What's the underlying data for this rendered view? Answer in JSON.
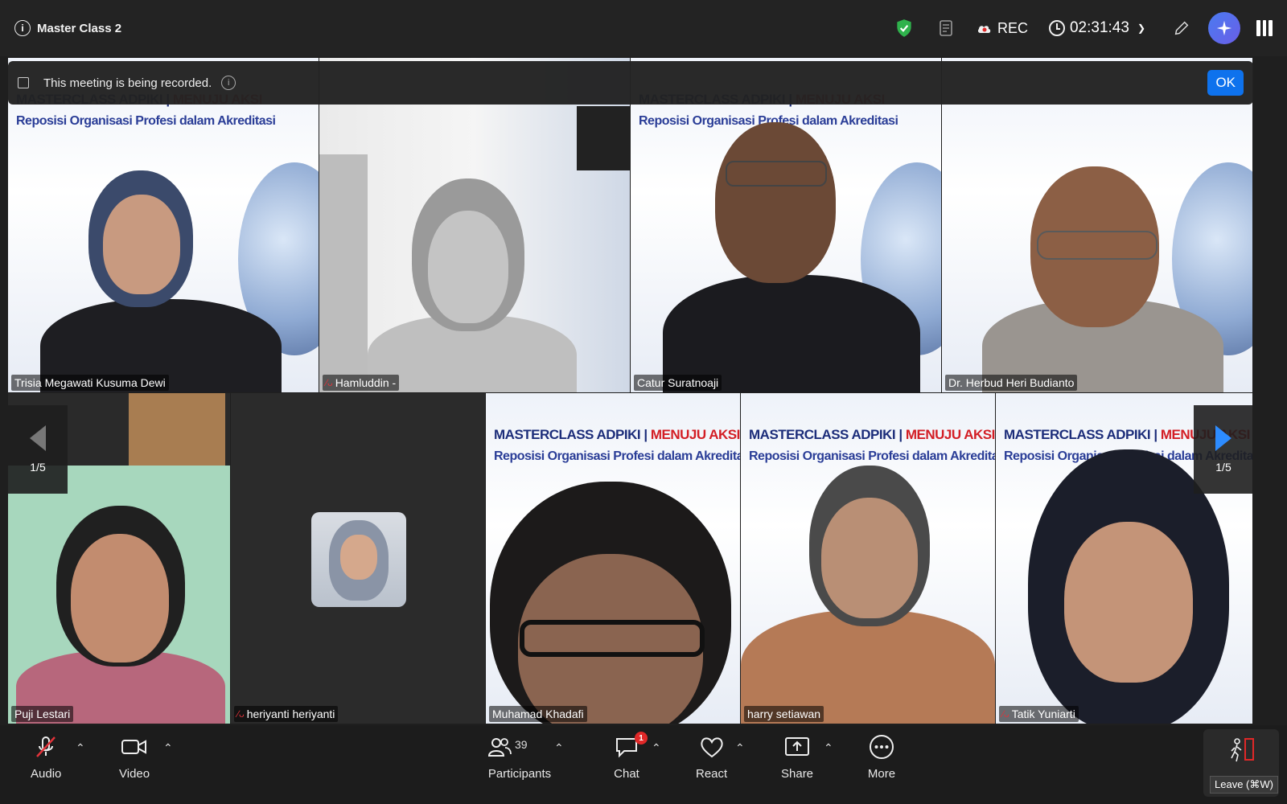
{
  "meeting": {
    "title": "Master Class 2"
  },
  "topbar": {
    "rec_label": "REC",
    "timer": "02:31:43"
  },
  "notice": {
    "message": "This meeting is being recorded.",
    "ok_label": "OK"
  },
  "banner": {
    "line1": "MASTERCLASS ADPIKI |",
    "line1_red": "MENUJU AKSI",
    "line2": "Reposisi Organisasi Profesi dalam Akreditasi"
  },
  "pagination": {
    "left": "1/5",
    "right": "1/5"
  },
  "participants": [
    {
      "name": "Trisia Megawati Kusuma Dewi",
      "muted": false
    },
    {
      "name": "Hamluddin -",
      "muted": true
    },
    {
      "name": "Catur Suratnoaji",
      "muted": false
    },
    {
      "name": "Dr. Herbud Heri Budianto",
      "muted": false
    },
    {
      "name": "Puji Lestari",
      "muted": false
    },
    {
      "name": "heriyanti heriyanti",
      "muted": true
    },
    {
      "name": "Muhamad Khadafi",
      "muted": false
    },
    {
      "name": "harry setiawan",
      "muted": false
    },
    {
      "name": "Tatik Yuniarti",
      "muted": true
    }
  ],
  "toolbar": {
    "audio": "Audio",
    "video": "Video",
    "participants": "Participants",
    "participants_count": "39",
    "chat": "Chat",
    "chat_badge": "1",
    "react": "React",
    "share": "Share",
    "more": "More",
    "leave_tooltip": "Leave (⌘W)"
  },
  "colors": {
    "accent": "#0e72ed",
    "active_speaker": "#2fa84f",
    "muted": "#e2333a",
    "shield": "#2fb24c"
  }
}
